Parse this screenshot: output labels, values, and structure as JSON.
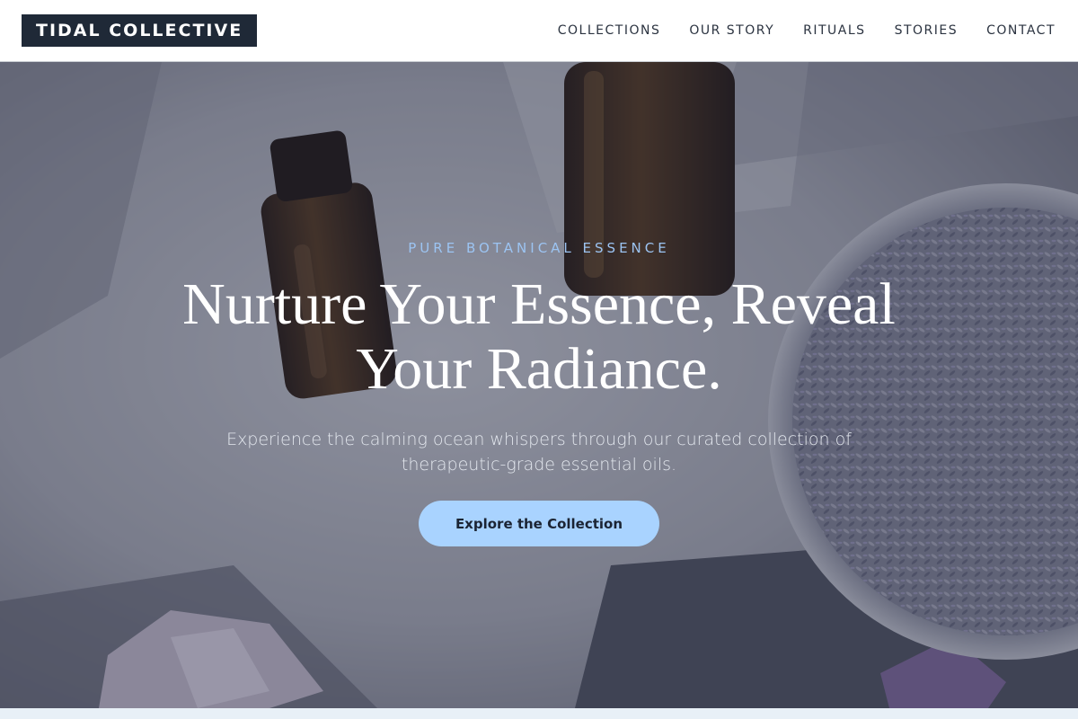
{
  "header": {
    "logo_text": "TIDAL COLLECTIVE",
    "nav": [
      {
        "label": "COLLECTIONS"
      },
      {
        "label": "OUR STORY"
      },
      {
        "label": "RITUALS"
      },
      {
        "label": "STORIES"
      },
      {
        "label": "CONTACT"
      }
    ]
  },
  "hero": {
    "eyebrow": "PURE BOTANICAL ESSENCE",
    "headline": "Nurture Your Essence, Reveal Your Radiance.",
    "subtext": "Experience the calming ocean whispers through our curated collection of therapeutic-grade essential oils.",
    "cta_label": "Explore the Collection",
    "background_image": "essential oil bottles on linen cloth with bowl of dried lavender and crystals"
  },
  "colors": {
    "header_bg": "#ffffff",
    "logo_bg": "#1f2937",
    "eyebrow": "#9cc4f2",
    "cta_bg": "#a9d3ff",
    "overlay": "#212844"
  }
}
